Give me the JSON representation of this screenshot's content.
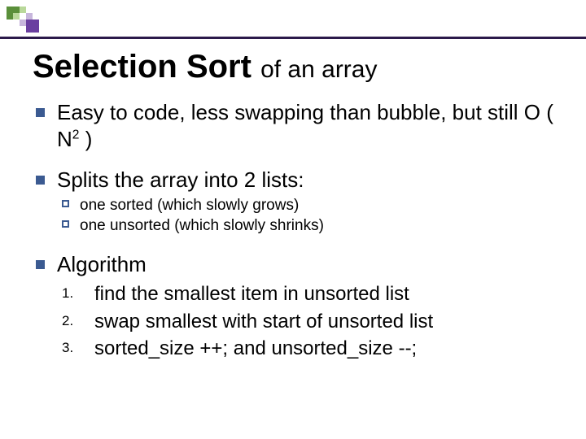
{
  "title": {
    "main": "Selection Sort",
    "sub": "of an array"
  },
  "bullets": {
    "b1": {
      "pre": "Easy to code, less swapping than bubble, but still O ( N",
      "exp": "2",
      "post": " )"
    },
    "b2": {
      "text": "Splits the array into 2 lists:",
      "subs": {
        "s1": "one sorted (which slowly grows)",
        "s2": "one unsorted (which slowly shrinks)"
      }
    },
    "b3": {
      "text": "Algorithm",
      "steps": {
        "a1": "find the smallest item in unsorted list",
        "a2": "swap smallest with start of unsorted list",
        "a3": "sorted_size ++; and unsorted_size --;"
      }
    }
  }
}
